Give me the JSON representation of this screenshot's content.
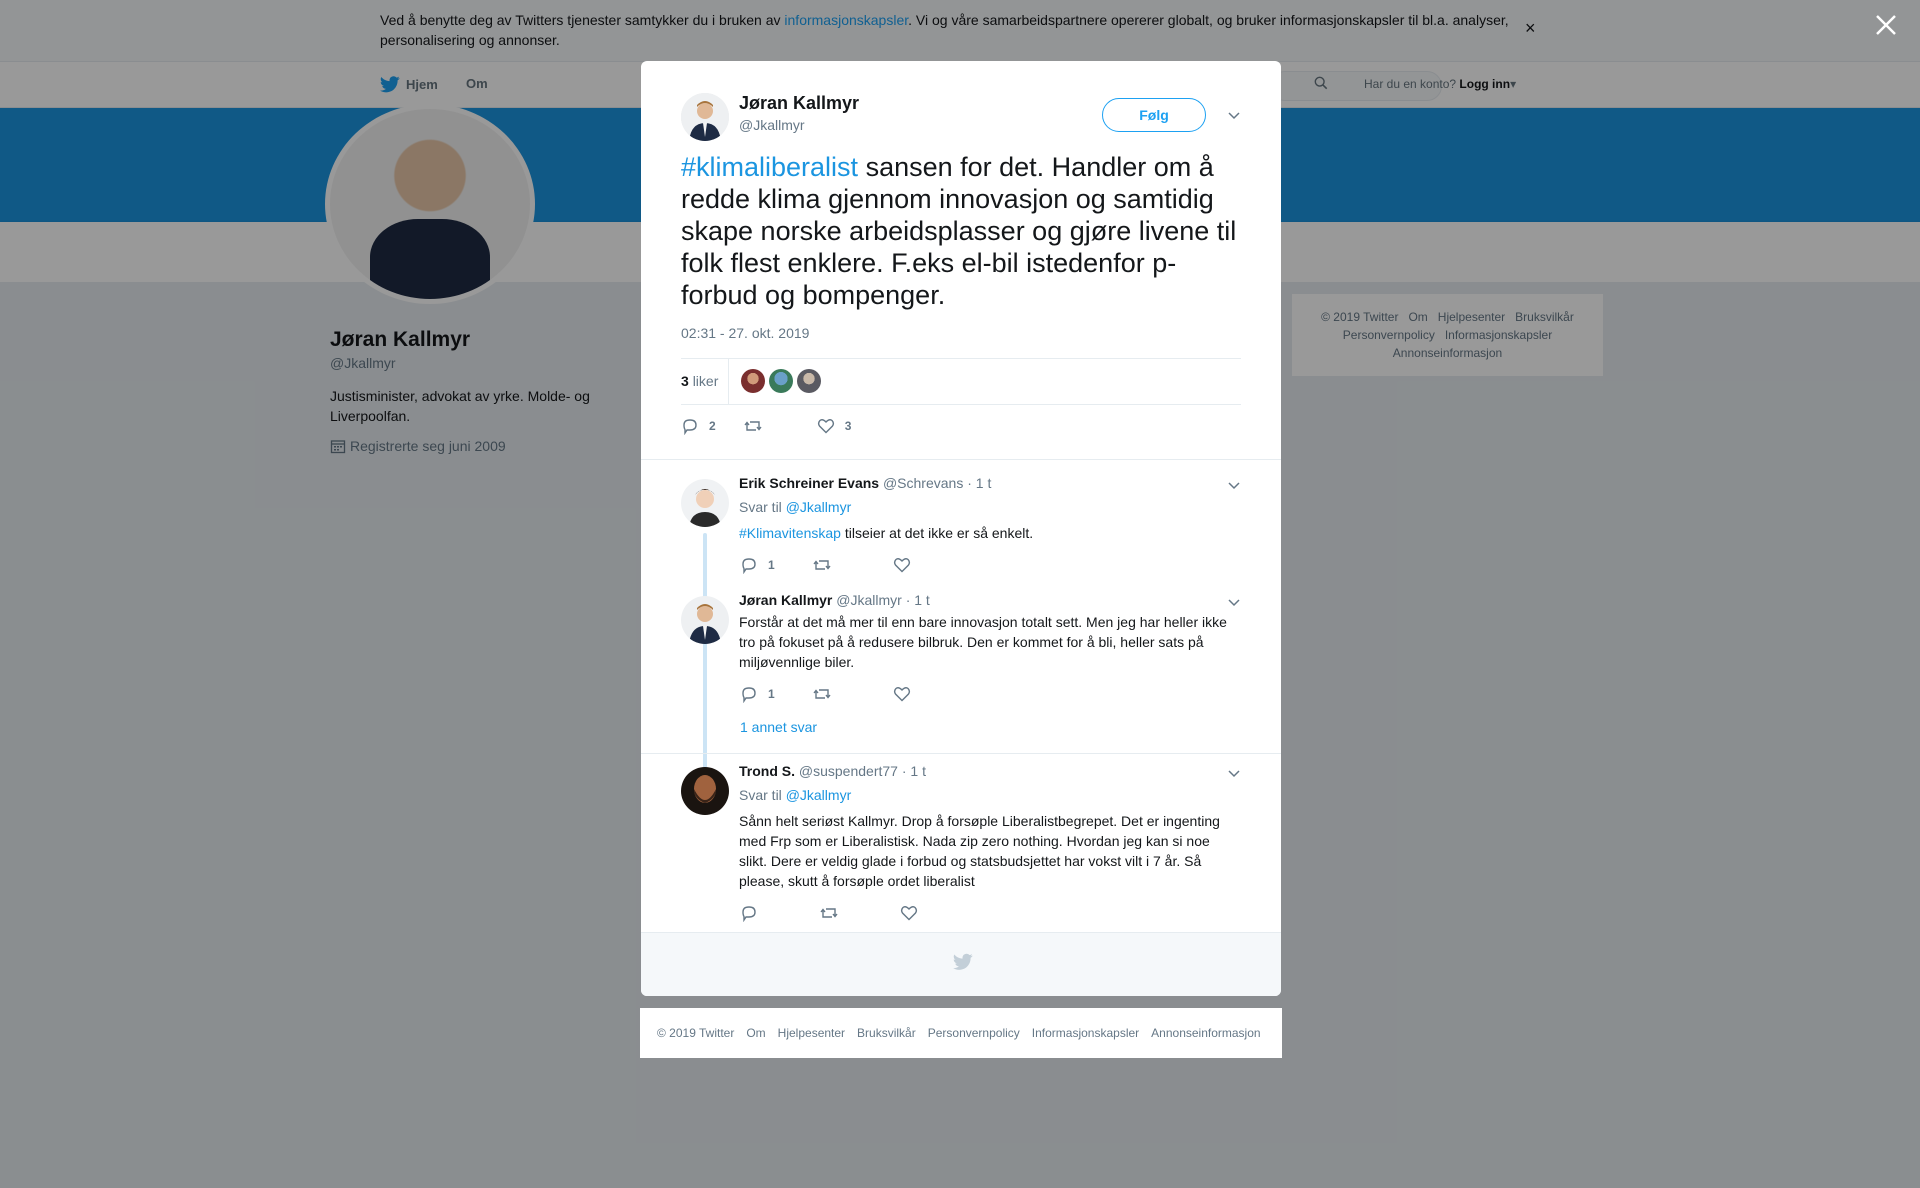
{
  "cookie_banner": {
    "text_before": "Ved å benytte deg av Twitters tjenester samtykker du i bruken av ",
    "link": "informasjonskapsler",
    "text_after": ". Vi og våre samarbeidspartnere opererer globalt, og bruker informasjonskapsler til bl.a. analyser, personalisering og annonser.",
    "close": "×"
  },
  "nav": {
    "home": "Hjem",
    "about": "Om",
    "login_prompt": "Har du en konto?",
    "login": "Logg inn"
  },
  "profile": {
    "name": "Jøran Kallmyr",
    "handle": "@Jkallmyr",
    "bio": "Justisminister, advokat av yrke. Molde- og Liverpoolfan.",
    "joined": "Registrerte seg juni 2009"
  },
  "side_footer": {
    "items": [
      "© 2019 Twitter",
      "Om",
      "Hjelpesenter",
      "Bruksvilkår",
      "Personvernpolicy",
      "Informasjonskapsler",
      "Annonseinformasjon"
    ]
  },
  "tweet": {
    "author_name": "Jøran Kallmyr",
    "author_handle": "@Jkallmyr",
    "follow_label": "Følg",
    "hashtag": "#klimaliberalist",
    "text": " sansen for det. Handler om å redde klima gjennom innovasjon og samtidig skape norske arbeidsplasser og gjøre livene til folk flest enklere. F.eks el-bil istedenfor p-forbud og bompenger.",
    "timestamp": "02:31 - 27. okt. 2019",
    "likes_count": "3",
    "likes_label": "liker",
    "reply_count": "2",
    "like_count": "3"
  },
  "replies": [
    {
      "name": "Erik Schreiner Evans",
      "handle": "@Schrevans",
      "time": "· 1 t",
      "reply_to_label": "Svar til",
      "reply_to": "@Jkallmyr",
      "hashtag": "#Klimavitenskap",
      "text": " tilseier at det ikke er så enkelt.",
      "reply_count": "1"
    },
    {
      "name": "Jøran Kallmyr",
      "handle": "@Jkallmyr",
      "time": "· 1 t",
      "text": "Forstår at det må mer til enn bare innovasjon totalt sett. Men jeg har heller ikke tro på fokuset på å redusere bilbruk. Den er kommet for å bli, heller sats på miljøvennlige biler.",
      "reply_count": "1"
    },
    {
      "name": "Trond S.",
      "handle": "@suspendert77",
      "time": "· 1 t",
      "reply_to_label": "Svar til",
      "reply_to": "@Jkallmyr",
      "text": "Sånn helt seriøst Kallmyr. Drop å forsøple Liberalistbegrepet. Det er ingenting med Frp som er Liberalistisk. Nada zip zero nothing. Hvordan jeg kan si noe slikt. Dere er veldig glade i forbud og statsbudsjettet har vokst vilt i 7 år. Så please, skutt å forsøple ordet liberalist"
    }
  ],
  "more_replies": "1 annet svar",
  "bottom_footer": {
    "items": [
      "© 2019 Twitter",
      "Om",
      "Hjelpesenter",
      "Bruksvilkår",
      "Personvernpolicy",
      "Informasjonskapsler",
      "Annonseinformasjon"
    ]
  },
  "colors": {
    "accent": "#1da1f2",
    "link": "#1b95e0",
    "banner": "#1b95e0",
    "muted": "#657786"
  },
  "icons": [
    "close-icon",
    "twitter-bird-icon",
    "search-icon",
    "calendar-icon",
    "chevron-down-icon",
    "reply-icon",
    "retweet-icon",
    "heart-icon"
  ]
}
